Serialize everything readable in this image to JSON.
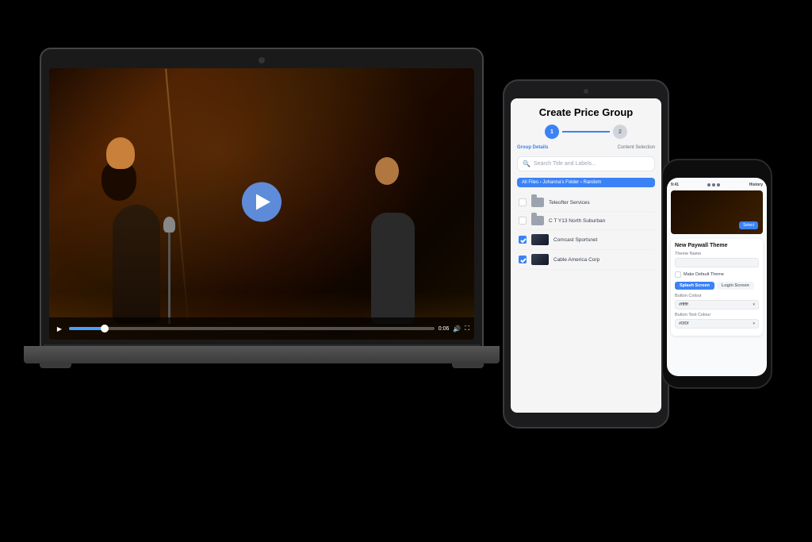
{
  "scene": {
    "background": "#000000"
  },
  "laptop": {
    "video": {
      "play_button_label": "Play",
      "time": "0:06",
      "progress_percent": 10
    },
    "controls": {
      "play": "▶",
      "volume": "🔊",
      "fullscreen": "⛶",
      "time": "0:06"
    }
  },
  "tablet": {
    "title": "Create Price Group",
    "stepper": {
      "step1_label": "Group Details",
      "step2_label": "Content Selection",
      "step1_number": "1",
      "step2_number": "2"
    },
    "search": {
      "placeholder": "Search Title and Labels..."
    },
    "breadcrumb": "All Files › Johanna's Folder › Random",
    "files": [
      {
        "name": "Teleofter Services",
        "type": "folder",
        "checked": false
      },
      {
        "name": "C T Y13 North Suburban",
        "type": "folder",
        "checked": false
      },
      {
        "name": "Comcast Sportsnet",
        "type": "video",
        "checked": true
      },
      {
        "name": "Cable America Corp",
        "type": "video",
        "checked": true
      }
    ]
  },
  "phone": {
    "top_bar": {
      "left": "9:41",
      "right": "History"
    },
    "video_section": {
      "button_label": "Select"
    },
    "paywall_section": {
      "title": "New Paywall Theme",
      "theme_name_label": "Theme Name",
      "theme_name_placeholder": "",
      "default_checkbox_label": "Make Default Theme",
      "tab_splash": "Splash Screen",
      "tab_login": "Login Screen",
      "button_colour_label": "Button Colour",
      "button_colour_value": "#ffffff",
      "button_text_colour_label": "Button Text Colour",
      "button_text_colour_value": "#0f0f"
    }
  }
}
